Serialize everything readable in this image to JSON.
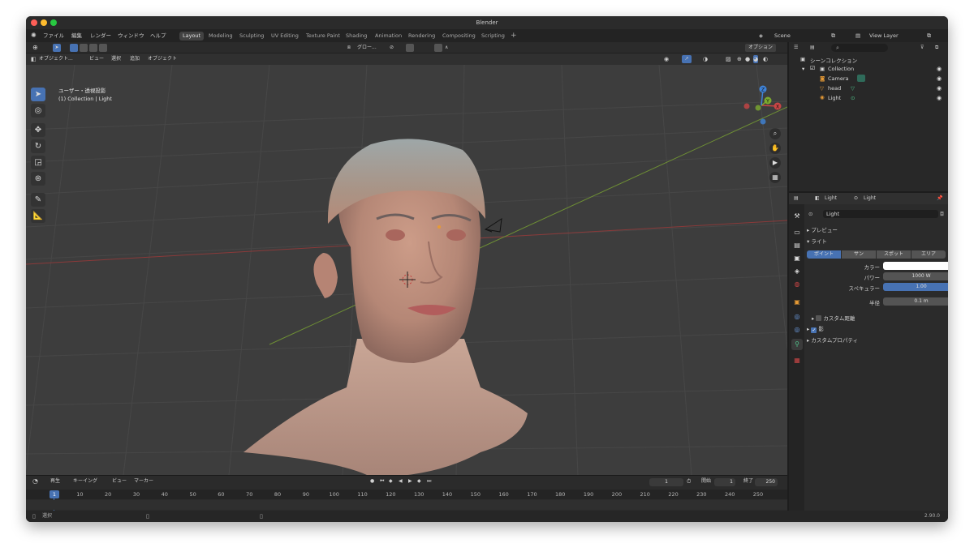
{
  "window": {
    "title": "Blender"
  },
  "menubar": {
    "menus": [
      "ファイル",
      "編集",
      "レンダー",
      "ウィンドウ",
      "ヘルプ"
    ],
    "workspaces": [
      "Layout",
      "Modeling",
      "Sculpting",
      "UV Editing",
      "Texture Paint",
      "Shading",
      "Animation",
      "Rendering",
      "Compositing",
      "Scripting"
    ],
    "active_workspace": "Layout",
    "scene": "Scene",
    "view_layer": "View Layer"
  },
  "header": {
    "mode": "オブジェクト...",
    "menus": [
      "ビュー",
      "選択",
      "追加",
      "オブジェクト"
    ],
    "transform": "グロー...",
    "options": "オプション"
  },
  "viewport": {
    "view_name": "ユーザー・透視投影",
    "collection_info": "(1) Collection | Light",
    "gizmo_axes": [
      "X",
      "Y",
      "Z"
    ]
  },
  "timeline": {
    "menus": [
      "再生",
      "キーイング",
      "ビュー",
      "マーカー"
    ],
    "current_frame": "1",
    "start_label": "開始",
    "start": "1",
    "end_label": "終了",
    "end": "250",
    "ruler": [
      "10",
      "20",
      "30",
      "40",
      "50",
      "60",
      "70",
      "80",
      "90",
      "100",
      "110",
      "120",
      "130",
      "140",
      "150",
      "160",
      "170",
      "180",
      "190",
      "200",
      "210",
      "220",
      "230",
      "240",
      "250"
    ],
    "playhead": "1"
  },
  "statusbar": {
    "left": "選択",
    "version": "2.90.0"
  },
  "outliner": {
    "root": "シーンコレクション",
    "collection": "Collection",
    "items": [
      "Camera",
      "head",
      "Light"
    ]
  },
  "properties": {
    "object_name": "Light",
    "data_name": "Light",
    "datablock": "Light",
    "sections": {
      "preview": "プレビュー",
      "light": "ライト",
      "custom_distance": "カスタム距離",
      "shadow": "影",
      "custom_props": "カスタムプロパティ"
    },
    "light_types": [
      "ポイント",
      "サン",
      "スポット",
      "エリア"
    ],
    "active_type": "ポイント",
    "color_label": "カラー",
    "color": "#ffffff",
    "power_label": "パワー",
    "power": "1000 W",
    "specular_label": "スペキュラー",
    "specular": "1.00",
    "radius_label": "半径",
    "radius": "0.1 m"
  },
  "colors": {
    "accent": "#4772b3",
    "background": "#3d3d3d",
    "panel": "#2b2b2b"
  }
}
